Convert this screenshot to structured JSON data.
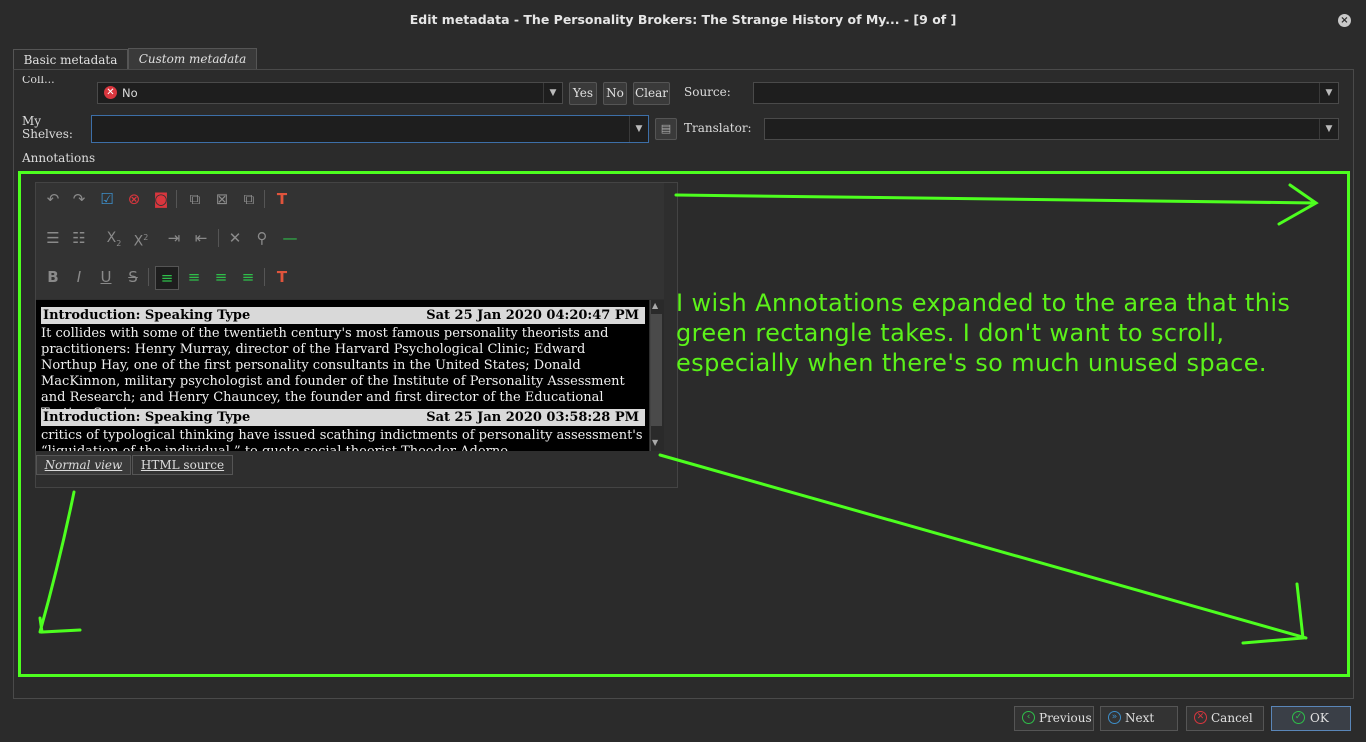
{
  "window": {
    "title": "Edit metadata - The Personality Brokers: The Strange History of My... -  [9 of         ]"
  },
  "tabs": [
    {
      "label": "Basic metadata"
    },
    {
      "label": "Custom metadata"
    }
  ],
  "form": {
    "first_row_label_partial": "Coll...",
    "read_value": "No",
    "yes_button": "Yes",
    "no_button": "No",
    "clear_button": "Clear",
    "source_label": "Source:",
    "source_value": "",
    "my_shelves_label_line1": "My",
    "my_shelves_label_line2": "Shelves:",
    "my_shelves_value": "",
    "translator_label": "Translator:",
    "translator_value": "",
    "annotations_label": "Annotations"
  },
  "editor": {
    "notes": [
      {
        "heading": "Introduction: Speaking Type",
        "date": "Sat 25 Jan 2020 04:20:47 PM",
        "body": "It collides with some of the twentieth century's most famous personality theorists and practitioners: Henry Murray, director of the Harvard Psychological Clinic; Edward Northup Hay, one of the first personality consultants in the United States; Donald MacKinnon, military psychologist and founder of the Institute of Personality Assessment and Research; and Henry Chauncey, the founder and first director of the Educational Testing Service."
      },
      {
        "heading": "Introduction: Speaking Type",
        "date": "Sat 25 Jan 2020 03:58:28 PM",
        "body": "critics of typological thinking have issued scathing indictments of personality assessment's “liquidation of the individual,” to quote social theorist Theodor Adorno"
      }
    ],
    "view_tabs": [
      "Normal view",
      "HTML source"
    ]
  },
  "annotation_overlay": {
    "text": "I wish Annotations expanded to the area that this green rectangle takes. I don't want to scroll, especially when there's so much unused space.",
    "color": "#4dff1f"
  },
  "buttons": {
    "previous": "Previous",
    "next": "Next",
    "cancel": "Cancel",
    "ok": "OK"
  },
  "colors": {
    "background": "#2b2b2b",
    "accent_green": "#4dff1f",
    "no_icon_red": "#d9363e"
  }
}
